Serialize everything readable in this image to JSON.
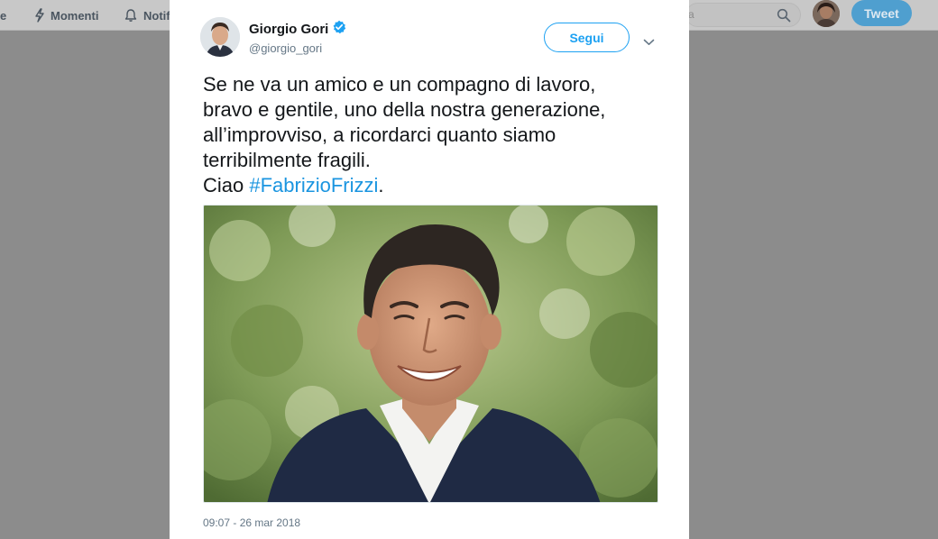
{
  "nav": {
    "home_fragment": "e",
    "moments_label": "Momenti",
    "notifications_fragment": "Notifi",
    "search_fragment": "a",
    "tweet_button": "Tweet"
  },
  "tweet": {
    "author_name": "Giorgio Gori",
    "author_handle": "@giorgio_gori",
    "follow_label": "Segui",
    "text_lines": [
      "Se ne va un amico e un compagno di lavoro,",
      "bravo e gentile, uno della nostra generazione,",
      "all’improvviso, a ricordarci quanto siamo",
      "terribilmente fragili."
    ],
    "last_line_prefix": "Ciao ",
    "hashtag": "#FabrizioFrizzi",
    "last_line_suffix": ".",
    "timestamp": "09:07 - 26 mar 2018"
  },
  "colors": {
    "accent": "#1da1f2",
    "hashtag": "#1b95e0",
    "overlay": "#8c8c8c"
  },
  "icons": [
    "home-icon",
    "lightning-icon",
    "bell-icon",
    "search-icon",
    "verified-badge-icon",
    "chevron-down-icon"
  ]
}
